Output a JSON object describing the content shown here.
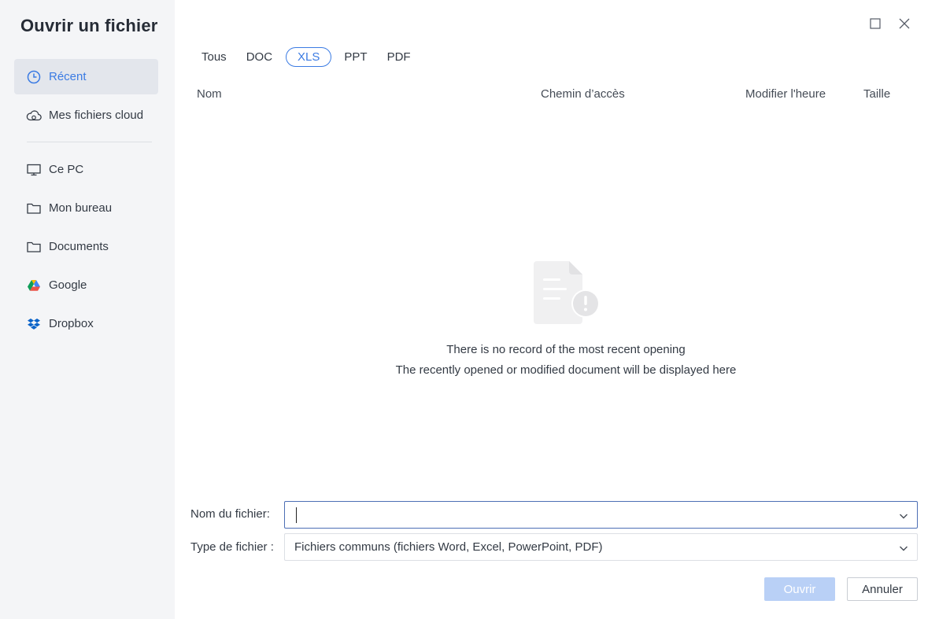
{
  "window": {
    "title": "Ouvrir un fichier"
  },
  "sidebar": {
    "items": [
      {
        "label": "Récent",
        "icon": "clock-icon"
      },
      {
        "label": "Mes fichiers cloud",
        "icon": "cloud-icon"
      },
      {
        "label": "Ce PC",
        "icon": "monitor-icon"
      },
      {
        "label": "Mon bureau",
        "icon": "folder-icon"
      },
      {
        "label": "Documents",
        "icon": "folder-icon"
      },
      {
        "label": "Google",
        "icon": "google-drive-icon"
      },
      {
        "label": "Dropbox",
        "icon": "dropbox-icon"
      }
    ]
  },
  "tabs": [
    {
      "label": "Tous"
    },
    {
      "label": "DOC"
    },
    {
      "label": "XLS"
    },
    {
      "label": "PPT"
    },
    {
      "label": "PDF"
    }
  ],
  "columns": {
    "name": "Nom",
    "path": "Chemin d’accès",
    "modified": "Modifier l'heure",
    "size": "Taille"
  },
  "empty_state": {
    "line1": "There is no record of the most recent opening",
    "line2": "The recently opened or modified document will be displayed here"
  },
  "form": {
    "filename_label": "Nom du fichier:",
    "filename_value": "",
    "filetype_label": "Type de fichier :",
    "filetype_value": "Fichiers communs (fichiers Word, Excel, PowerPoint, PDF)"
  },
  "buttons": {
    "open": "Ouvrir",
    "cancel": "Annuler"
  },
  "colors": {
    "accent": "#3b7be3",
    "sidebar_bg": "#f4f5f7",
    "active_item_bg": "#e3e6ec",
    "disabled_button": "#b9d0f6"
  }
}
